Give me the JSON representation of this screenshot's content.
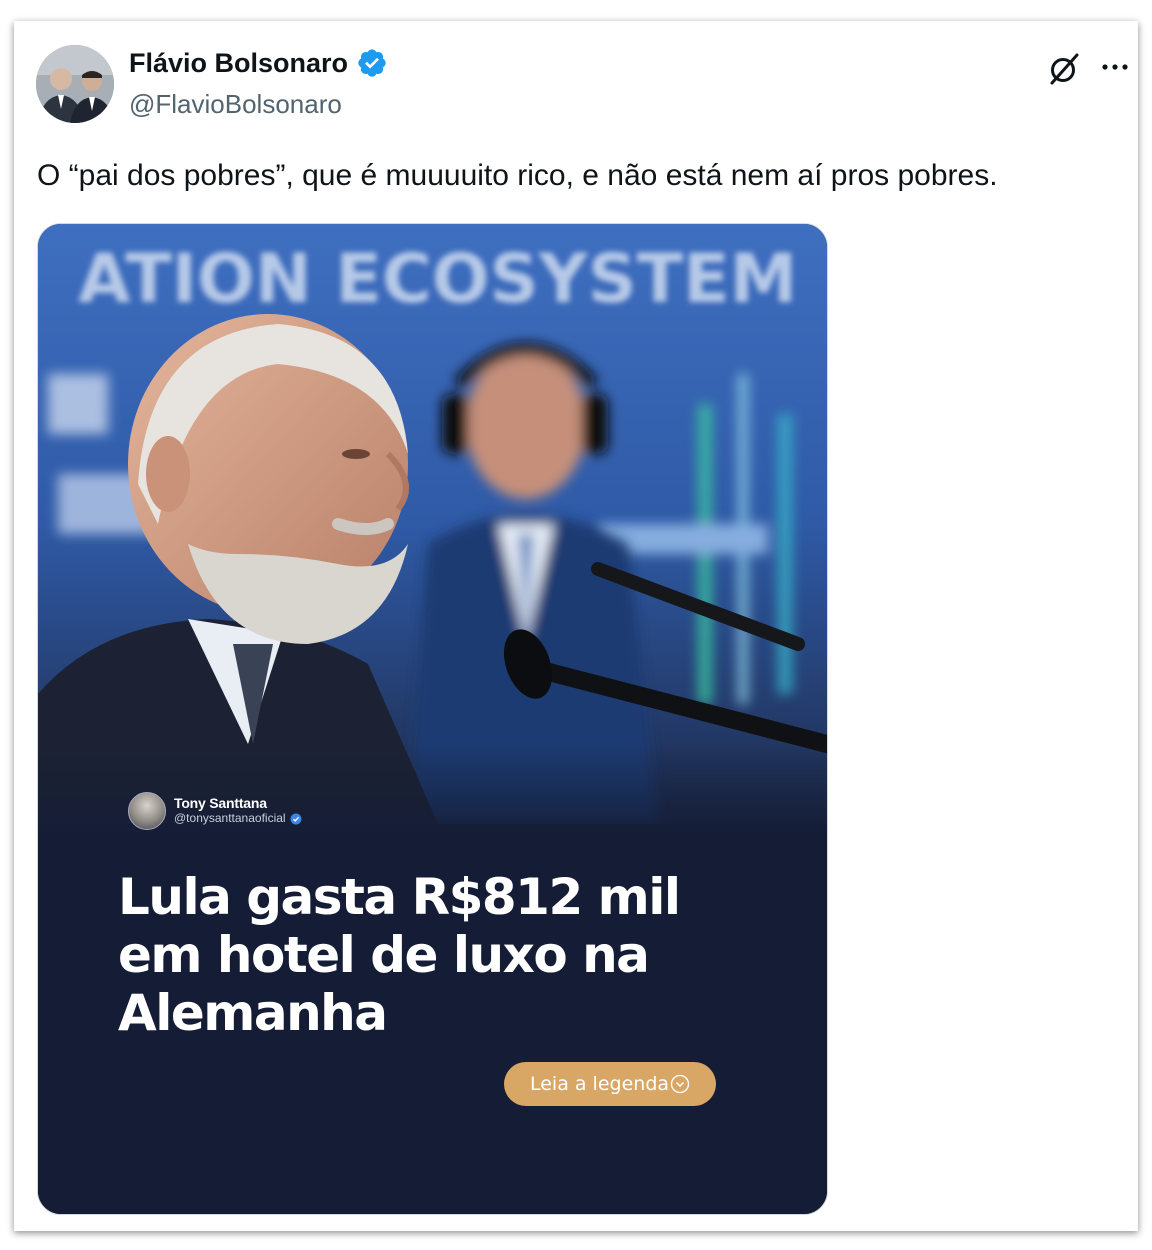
{
  "tweet": {
    "author": {
      "display_name": "Flávio Bolsonaro",
      "handle": "@FlavioBolsonaro",
      "verified": true
    },
    "text": "O “pai dos pobres”, que é muuuuito rico, e não está nem aí pros pobres.",
    "media": {
      "post_author": {
        "name": "Tony Santtana",
        "handle": "@tonysanttanaoficial",
        "verified": true
      },
      "headline": "Lula gasta R$812 mil em hotel de luxo na Alemanha",
      "cta_label": "Leia a legenda",
      "background_sign_text": "ATION ECOSYSTEM",
      "colors": {
        "panel": "#151d36",
        "cta": "#d8a766"
      }
    }
  },
  "icons": {
    "verified": "verified-badge-icon",
    "grok": "grok-icon",
    "more": "more-options-icon",
    "cta_chevron": "chevron-down-circle-icon"
  },
  "colors": {
    "verified_blue": "#1d9bf0",
    "text_primary": "#0f1419",
    "text_secondary": "#536471"
  }
}
